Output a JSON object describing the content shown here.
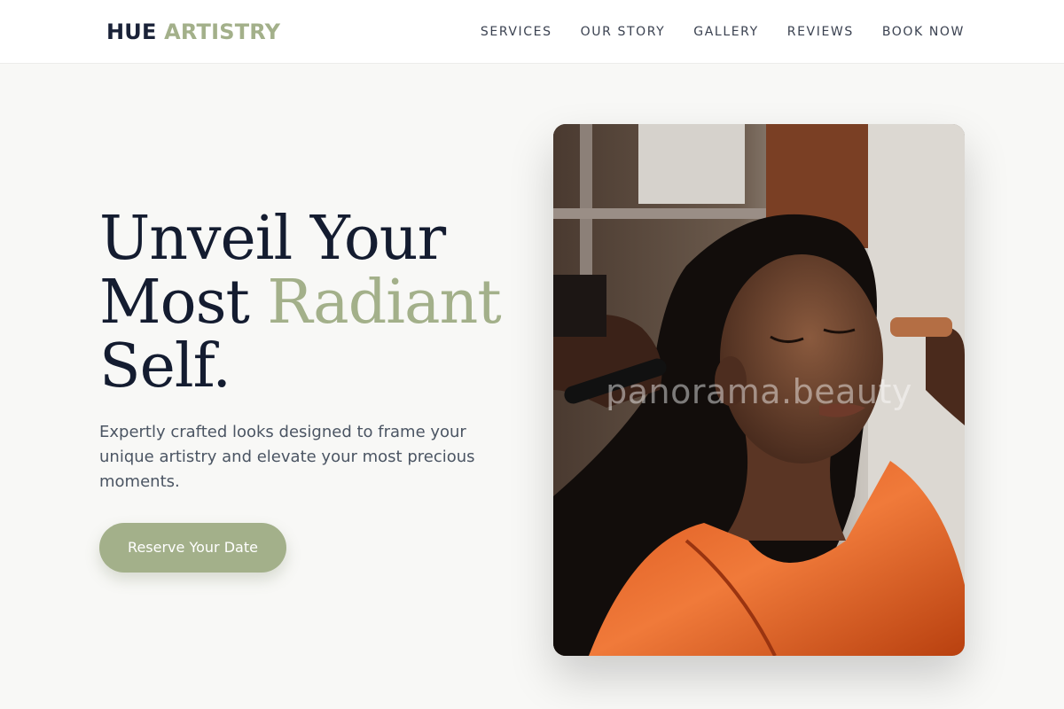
{
  "brand": {
    "part1": "HUE",
    "part2": "ARTISTRY"
  },
  "nav": {
    "items": [
      {
        "label": "SERVICES"
      },
      {
        "label": "OUR STORY"
      },
      {
        "label": "GALLERY"
      },
      {
        "label": "REVIEWS"
      },
      {
        "label": "BOOK NOW"
      }
    ]
  },
  "hero": {
    "title_line1": "Unveil Your",
    "title_line2_start": "Most ",
    "title_accent": "Radiant",
    "title_line3": "Self.",
    "description": "Expertly crafted looks designed to frame your unique artistry and elevate your most precious moments.",
    "cta_label": "Reserve Your Date",
    "image_watermark": "panorama.beauty"
  },
  "colors": {
    "accent": "#a3b08a",
    "heading": "#141c30",
    "body_text": "#4b5563",
    "background": "#f8f8f6"
  }
}
